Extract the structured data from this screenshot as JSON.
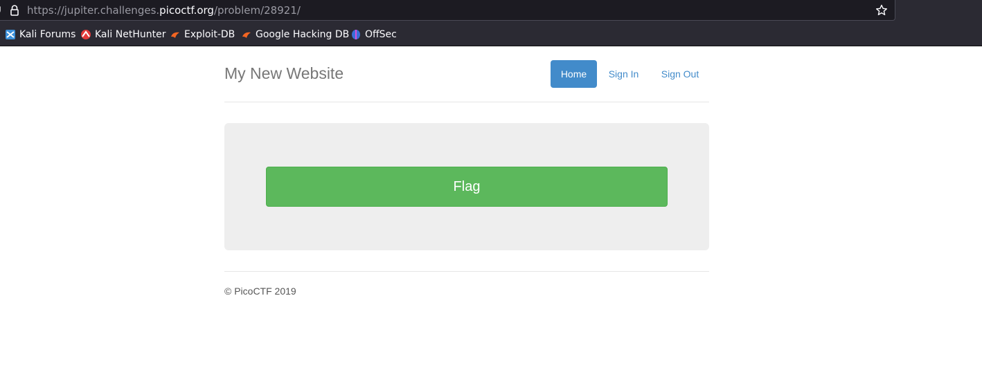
{
  "browser": {
    "url_prefix": "https://jupiter.challenges.",
    "url_domain": "picoctf.org",
    "url_path": "/problem/28921/",
    "bookmarks": [
      {
        "label": "Kali Forums",
        "icon": "kali-forums-icon"
      },
      {
        "label": "Kali NetHunter",
        "icon": "kali-nethunter-icon"
      },
      {
        "label": "Exploit-DB",
        "icon": "exploit-db-icon"
      },
      {
        "label": "Google Hacking DB",
        "icon": "google-hacking-db-icon"
      },
      {
        "label": "OffSec",
        "icon": "offsec-icon"
      }
    ]
  },
  "page": {
    "site_title": "My New Website",
    "nav": [
      {
        "label": "Home",
        "active": true
      },
      {
        "label": "Sign In",
        "active": false
      },
      {
        "label": "Sign Out",
        "active": false
      }
    ],
    "flag_button": "Flag",
    "footer": "© PicoCTF 2019"
  },
  "colors": {
    "primary": "#428bca",
    "success": "#5cb85c",
    "jumbotron_bg": "#eeeeee",
    "chrome_bg": "#2b2a33"
  }
}
